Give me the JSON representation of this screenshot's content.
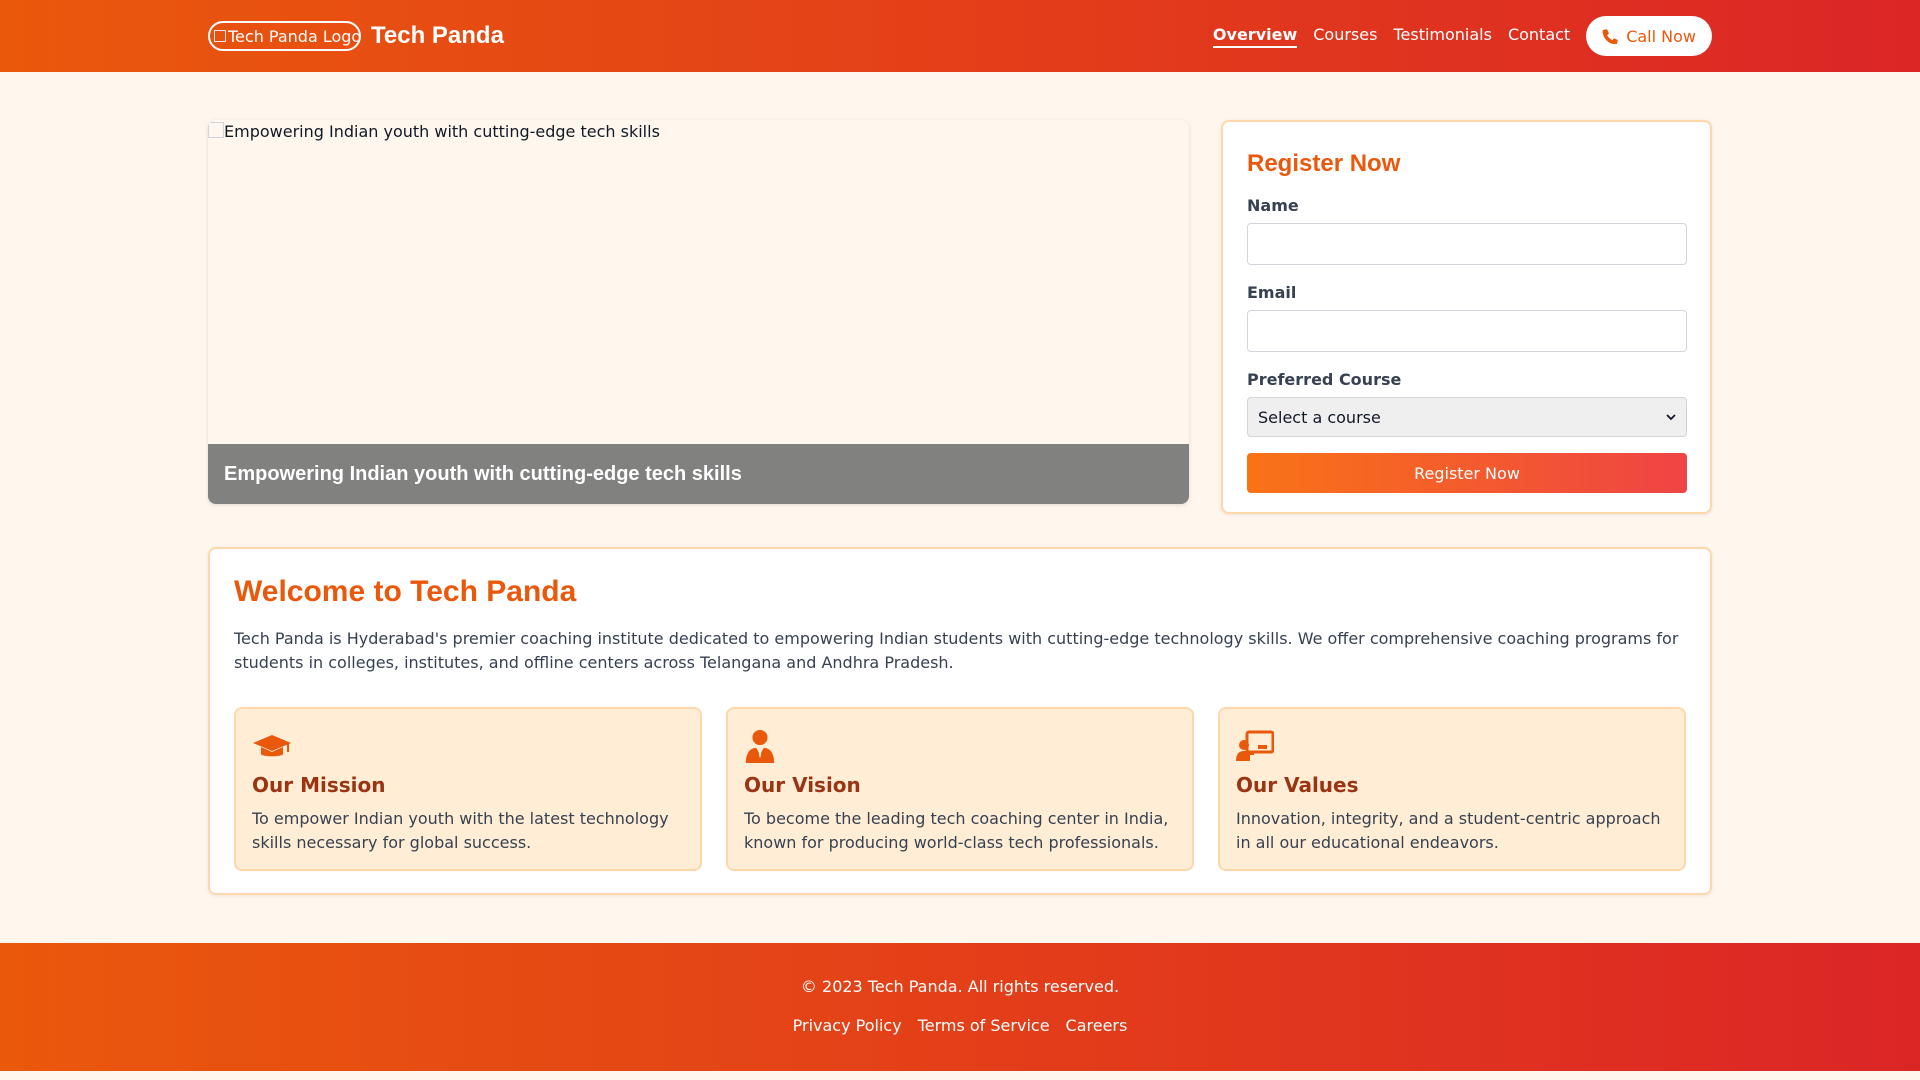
{
  "header": {
    "logo_alt": "Tech Panda Logo",
    "brand": "Tech Panda",
    "nav": [
      {
        "label": "Overview",
        "active": true
      },
      {
        "label": "Courses"
      },
      {
        "label": "Testimonials"
      },
      {
        "label": "Contact"
      }
    ],
    "call_label": "Call Now"
  },
  "hero": {
    "image_alt": "Empowering Indian youth with cutting-edge tech skills",
    "caption": "Empowering Indian youth with cutting-edge tech skills"
  },
  "register": {
    "title": "Register Now",
    "name_label": "Name",
    "name_value": "",
    "email_label": "Email",
    "email_value": "",
    "course_label": "Preferred Course",
    "course_selected": "Select a course",
    "submit_label": "Register Now"
  },
  "welcome": {
    "title": "Welcome to Tech Panda",
    "intro": "Tech Panda is Hyderabad's premier coaching institute dedicated to empowering Indian students with cutting-edge technology skills. We offer comprehensive coaching programs for students in colleges, institutes, and offline centers across Telangana and Andhra Pradesh.",
    "cards": [
      {
        "icon": "graduation-cap-icon",
        "title": "Our Mission",
        "text": "To empower Indian youth with the latest technology skills necessary for global success."
      },
      {
        "icon": "user-tie-icon",
        "title": "Our Vision",
        "text": "To become the leading tech coaching center in India, known for producing world-class tech professionals."
      },
      {
        "icon": "chalkboard-teacher-icon",
        "title": "Our Values",
        "text": "Innovation, integrity, and a student-centric approach in all our educational endeavors."
      }
    ]
  },
  "footer": {
    "copyright": "© 2023 Tech Panda. All rights reserved.",
    "links": [
      "Privacy Policy",
      "Terms of Service",
      "Careers"
    ]
  },
  "colors": {
    "primary": "#ea580c",
    "secondary": "#dc2626",
    "background": "#fff7ed",
    "card_bg": "#ffedd5",
    "card_title": "#9a3412"
  }
}
